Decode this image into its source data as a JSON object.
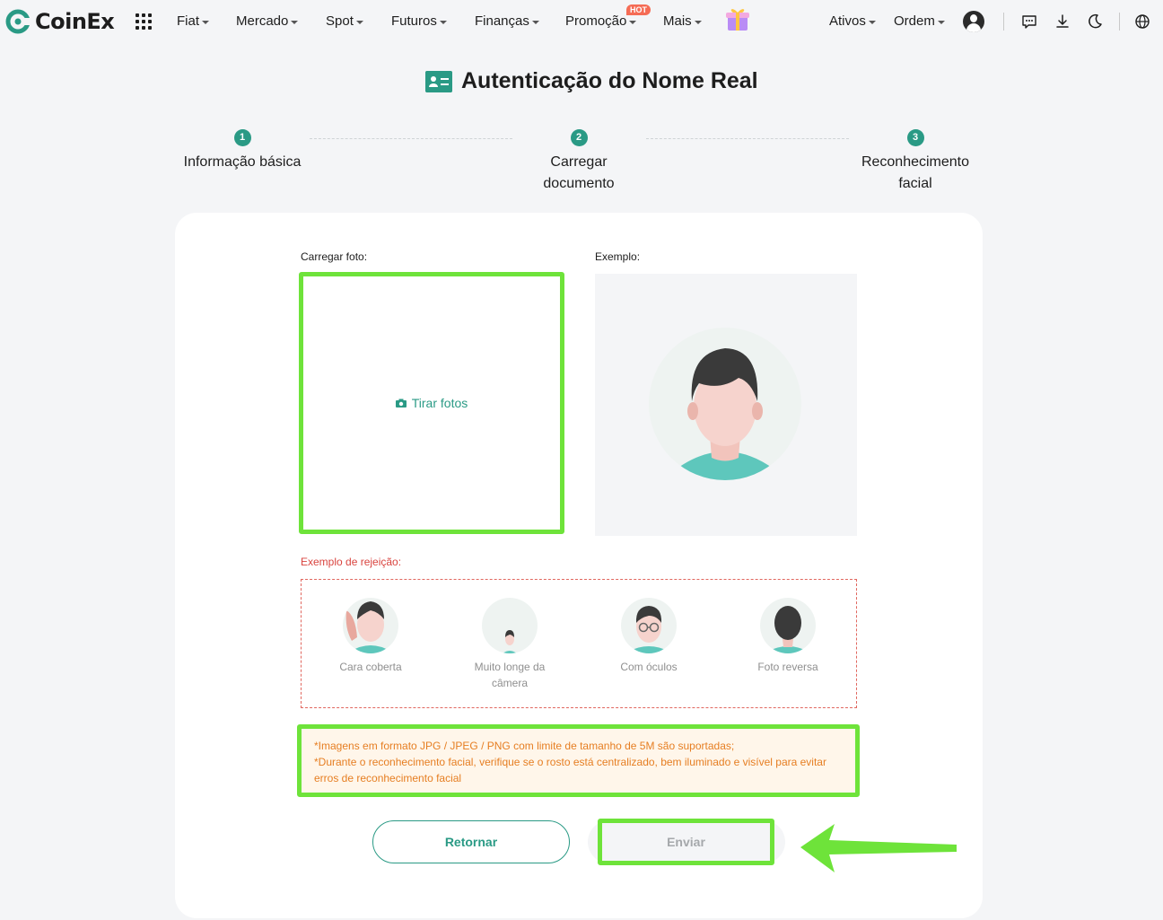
{
  "nav": {
    "logo_text": "CoinEx",
    "items": [
      {
        "label": "Fiat"
      },
      {
        "label": "Mercado"
      },
      {
        "label": "Spot"
      },
      {
        "label": "Futuros"
      },
      {
        "label": "Finanças"
      },
      {
        "label": "Promoção"
      },
      {
        "label": "Mais"
      }
    ],
    "hot_badge": "HOT",
    "right_items": [
      {
        "label": "Ativos"
      },
      {
        "label": "Ordem"
      }
    ],
    "icons": [
      "apps-grid-icon",
      "gift-icon",
      "avatar",
      "message-icon",
      "download-icon",
      "moon-icon",
      "globe-icon"
    ]
  },
  "page": {
    "title": "Autenticação do Nome Real"
  },
  "steps": [
    {
      "num": "1",
      "label": "Informação básica"
    },
    {
      "num": "2",
      "label_line1": "Carregar",
      "label_line2": "documento"
    },
    {
      "num": "3",
      "label_line1": "Reconhecimento",
      "label_line2": "facial"
    }
  ],
  "upload": {
    "label": "Carregar foto:",
    "button_label": "Tirar fotos"
  },
  "example": {
    "label": "Exemplo:"
  },
  "rejection": {
    "label": "Exemplo de rejeição:",
    "items": [
      {
        "label": "Cara coberta"
      },
      {
        "label_line1": "Muito longe da",
        "label_line2": "câmera"
      },
      {
        "label": "Com óculos"
      },
      {
        "label": "Foto reversa"
      }
    ]
  },
  "notice": {
    "line1": "*Imagens em formato JPG / JPEG / PNG com limite de tamanho de 5M são suportadas;",
    "line2": "*Durante o reconhecimento facial, verifique se o rosto está centralizado, bem iluminado e visível para evitar erros de reconhecimento facial"
  },
  "buttons": {
    "back": "Retornar",
    "submit": "Enviar"
  },
  "colors": {
    "brand": "#2a9a85",
    "highlight": "#6ee33a",
    "reject": "#d9443f",
    "notice": "#e67e22"
  }
}
